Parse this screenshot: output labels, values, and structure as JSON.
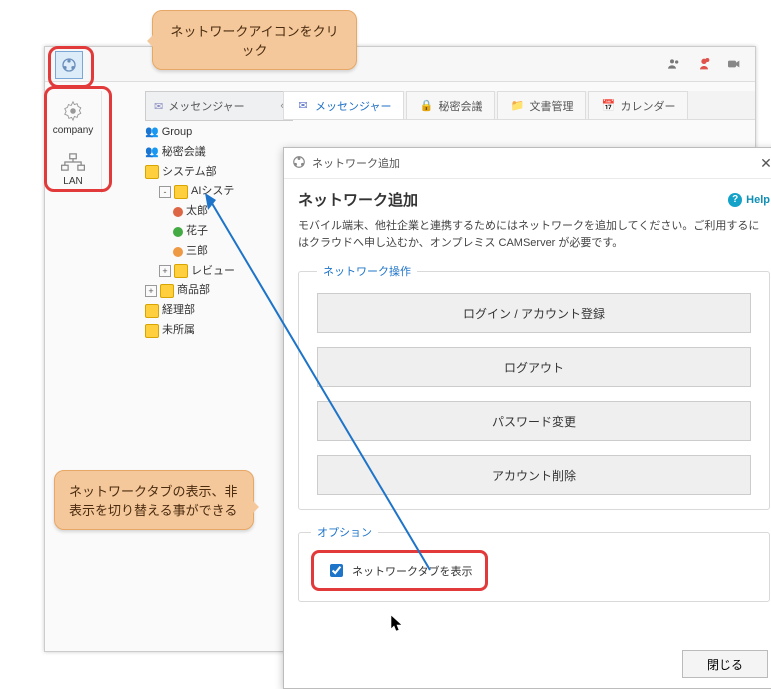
{
  "callouts": {
    "top": "ネットワークアイコンをクリック",
    "bottom": "ネットワークタブの表示、非表示を切り替える事ができる"
  },
  "sidebar": {
    "items": [
      {
        "label": "company"
      },
      {
        "label": "LAN"
      }
    ]
  },
  "left_panel_tab": "メッセンジャー",
  "nav": {
    "tabs": [
      {
        "label": "メッセンジャー",
        "active": true
      },
      {
        "label": "秘密会議",
        "active": false
      },
      {
        "label": "文書管理",
        "active": false
      },
      {
        "label": "カレンダー",
        "active": false
      }
    ]
  },
  "tree": {
    "group": "Group",
    "secret": "秘密会議",
    "system": "システム部",
    "ai": "AIシステ",
    "taro": "太郎",
    "hanako": "花子",
    "saburo": "三郎",
    "review": "レビュー",
    "product": "商品部",
    "accounting": "経理部",
    "unassigned": "未所属"
  },
  "dialog": {
    "window_title": "ネットワーク追加",
    "title": "ネットワーク追加",
    "help": "Help",
    "description": "モバイル端末、他社企業と連携するためにはネットワークを追加してください。ご利用するにはクラウドへ申し込むか、オンプレミス CAMServer が必要です。",
    "group1": {
      "legend": "ネットワーク操作",
      "buttons": [
        "ログイン / アカウント登録",
        "ログアウト",
        "パスワード変更",
        "アカウント削除"
      ]
    },
    "group2": {
      "legend": "オプション",
      "checkbox_label": "ネットワークタブを表示"
    },
    "close": "閉じる"
  }
}
